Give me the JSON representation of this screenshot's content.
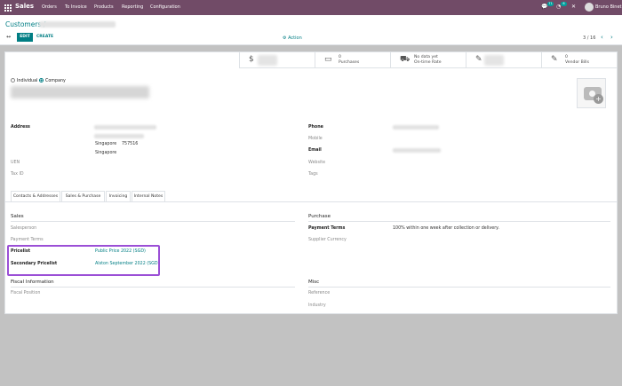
{
  "navbar": {
    "brand": "Sales",
    "menu": [
      "Orders",
      "To Invoice",
      "Products",
      "Reporting",
      "Configuration"
    ],
    "chat_badge": "71",
    "activity_badge": "6",
    "user": "Bruno Binet"
  },
  "control": {
    "breadcrumb": "Customers /",
    "edit_label": "EDIT",
    "create_label": "CREATE",
    "action_label": "Action",
    "pager": "3 / 16"
  },
  "smart_buttons": [
    {
      "icon": "dollar-icon",
      "line1": "",
      "line2": ""
    },
    {
      "icon": "card-icon",
      "line1": "0",
      "line2": "Purchases"
    },
    {
      "icon": "truck-icon",
      "line1": "No data yet",
      "line2": "On-time Rate"
    },
    {
      "icon": "edit-icon",
      "line1": "",
      "line2": ""
    },
    {
      "icon": "edit-icon",
      "line1": "0",
      "line2": "Vendor Bills"
    }
  ],
  "form": {
    "type_individual": "Individual",
    "type_company": "Company",
    "address_label": "Address",
    "city_line": "Singapore",
    "zip": "757516",
    "country": "Singapore",
    "uen_label": "UEN",
    "taxid_label": "Tax ID",
    "phone_label": "Phone",
    "mobile_label": "Mobile",
    "email_label": "Email",
    "website_label": "Website",
    "tags_label": "Tags"
  },
  "tabs": [
    "Contacts & Addresses",
    "Sales & Purchase",
    "Invoicing",
    "Internal Notes"
  ],
  "sales_purchase": {
    "sales_title": "Sales",
    "salesperson_label": "Salesperson",
    "payment_terms_label": "Payment Terms",
    "pricelist_label": "Pricelist",
    "pricelist_value": "Public Price 2022 (SGD)",
    "secondary_pricelist_label": "Secondary Pricelist",
    "secondary_pricelist_value": "Alston September 2022 (SGD)",
    "purchase_title": "Purchase",
    "purchase_payment_terms_label": "Payment Terms",
    "purchase_payment_terms_value": "100% within one week after collection or delivery.",
    "supplier_currency_label": "Supplier Currency",
    "fiscal_title": "Fiscal Information",
    "fiscal_position_label": "Fiscal Position",
    "misc_title": "Misc",
    "reference_label": "Reference",
    "industry_label": "Industry"
  },
  "colors": {
    "brand": "#714b67",
    "accent": "#017e84",
    "highlight": "#9b4fd6"
  }
}
